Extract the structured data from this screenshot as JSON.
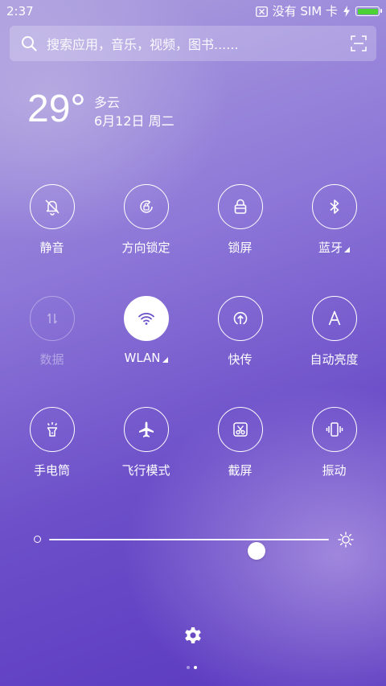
{
  "status_bar": {
    "time": "2:37",
    "sim_text": "没有 SIM 卡",
    "battery_level": 1.0,
    "battery_color": "#4cd137"
  },
  "search": {
    "placeholder": "搜索应用，音乐，视频，图书......",
    "icon": "search-icon",
    "scan_icon": "scan-icon"
  },
  "weather": {
    "temperature": "29°",
    "condition": "多云",
    "date": "6月12日 周二"
  },
  "toggles": [
    {
      "label": "静音",
      "icon": "bell-mute-icon",
      "state": "off"
    },
    {
      "label": "方向锁定",
      "icon": "rotation-lock-icon",
      "state": "off"
    },
    {
      "label": "锁屏",
      "icon": "lock-icon",
      "state": "off"
    },
    {
      "label": "蓝牙",
      "icon": "bluetooth-icon",
      "state": "off",
      "has_more": true
    },
    {
      "label": "数据",
      "icon": "mobile-data-icon",
      "state": "disabled"
    },
    {
      "label": "WLAN",
      "icon": "wifi-icon",
      "state": "on",
      "has_more": true
    },
    {
      "label": "快传",
      "icon": "transfer-icon",
      "state": "off"
    },
    {
      "label": "自动亮度",
      "icon": "auto-brightness-icon",
      "state": "off"
    },
    {
      "label": "手电筒",
      "icon": "flashlight-icon",
      "state": "off"
    },
    {
      "label": "飞行模式",
      "icon": "airplane-icon",
      "state": "off"
    },
    {
      "label": "截屏",
      "icon": "screenshot-icon",
      "state": "off"
    },
    {
      "label": "振动",
      "icon": "vibrate-icon",
      "state": "off"
    }
  ],
  "brightness": {
    "level": 0.74
  },
  "pager": {
    "pages": 2,
    "current": 2
  },
  "colors": {
    "accent_wifi": "#6a50c8"
  }
}
